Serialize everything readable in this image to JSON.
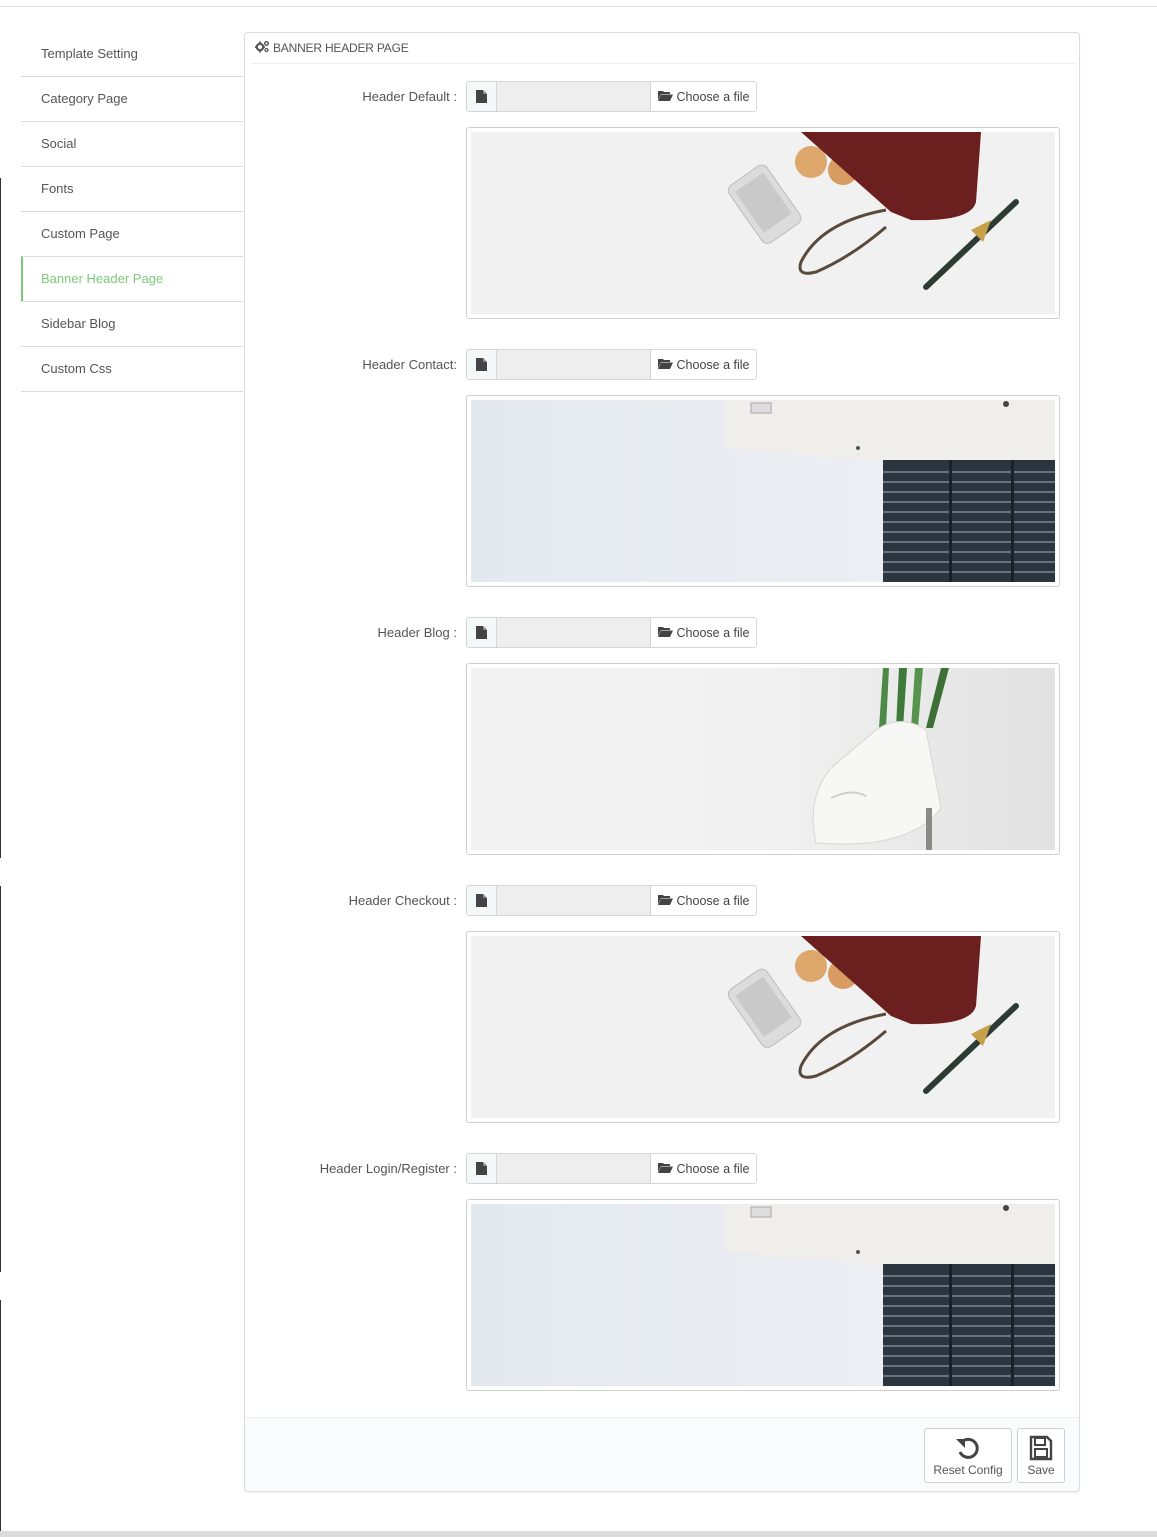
{
  "sidebar": {
    "items": [
      {
        "label": "Template Setting"
      },
      {
        "label": "Category Page"
      },
      {
        "label": "Social"
      },
      {
        "label": "Fonts"
      },
      {
        "label": "Custom Page"
      },
      {
        "label": "Banner Header Page",
        "active": true
      },
      {
        "label": "Sidebar Blog"
      },
      {
        "label": "Custom Css"
      }
    ]
  },
  "panel": {
    "title": "BANNER HEADER PAGE",
    "fields": [
      {
        "label": "Header Default :",
        "button": "Choose a file",
        "image": "bag-sunglasses-phone-watch"
      },
      {
        "label": "Header Contact:",
        "button": "Choose a file",
        "image": "building-window-blinds"
      },
      {
        "label": "Header Blog :",
        "button": "Choose a file",
        "image": "white-bag-plant"
      },
      {
        "label": "Header Checkout :",
        "button": "Choose a file",
        "image": "bag-sunglasses-phone-watch"
      },
      {
        "label": "Header Login/Register :",
        "button": "Choose a file",
        "image": "building-window-blinds"
      }
    ]
  },
  "footer": {
    "reset_label": "Reset Config",
    "save_label": "Save"
  },
  "colors": {
    "active": "#7cc97b",
    "border": "#dcdcdc"
  }
}
